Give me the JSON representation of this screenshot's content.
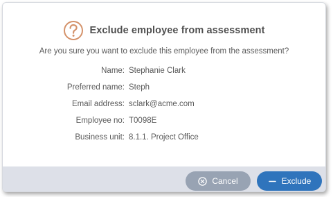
{
  "dialog": {
    "title": "Exclude employee from assessment",
    "question": "Are you sure you want to exclude this employee from the assessment?",
    "icon": "question-circle-icon",
    "colors": {
      "icon": "#d4926a",
      "cancel_button": "#98a3b3",
      "exclude_button": "#2f74bc",
      "footer": "#dde0e8"
    }
  },
  "details": [
    {
      "label": "Name:",
      "value": "Stephanie Clark"
    },
    {
      "label": "Preferred name:",
      "value": "Steph"
    },
    {
      "label": "Email address:",
      "value": "sclark@acme.com"
    },
    {
      "label": "Employee no:",
      "value": "T0098E"
    },
    {
      "label": "Business unit:",
      "value": "8.1.1. Project Office"
    }
  ],
  "buttons": {
    "cancel_label": "Cancel",
    "cancel_icon": "close-circle-icon",
    "exclude_label": "Exclude",
    "exclude_icon": "minus-icon"
  }
}
